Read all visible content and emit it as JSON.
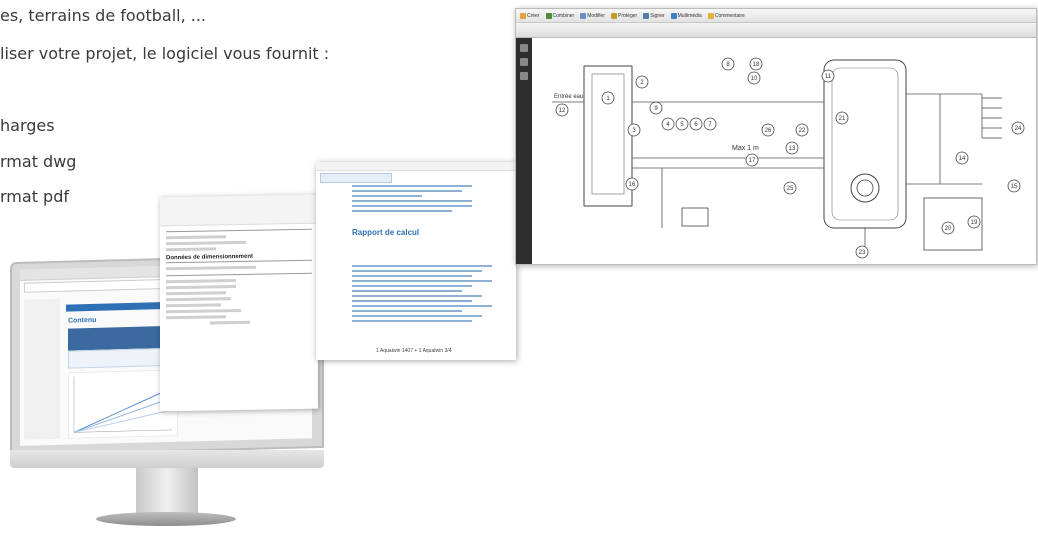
{
  "intro": {
    "line1": "es, terrains de football, ...",
    "line2": "liser votre projet, le logiciel vous fournit :",
    "line3": "harges",
    "line4": "rmat dwg",
    "line5": "rmat pdf"
  },
  "monitor_screen": {
    "page_title": "Contenu"
  },
  "form_window": {
    "section_title": "Données de dimensionnement"
  },
  "report_window": {
    "title": "Rapport de calcul",
    "footer": "1 Aquatwin 1407 + 1 Aquatwin 3/4"
  },
  "schematic_window": {
    "toolbar": [
      {
        "label": "Créer",
        "icon": "create-icon",
        "color": "#e8a13a"
      },
      {
        "label": "Combiner",
        "icon": "combine-icon",
        "color": "#4d8a3a"
      },
      {
        "label": "Modifier",
        "icon": "edit-icon",
        "color": "#6c8ec7"
      },
      {
        "label": "Protéger",
        "icon": "protect-icon",
        "color": "#c89a2e"
      },
      {
        "label": "Signer",
        "icon": "sign-icon",
        "color": "#5a78a8"
      },
      {
        "label": "Multimédia",
        "icon": "multimedia-icon",
        "color": "#3f7fbf"
      },
      {
        "label": "Commentaire",
        "icon": "comment-icon",
        "color": "#e2b23c"
      }
    ],
    "labels": {
      "inlet": "Entrée eau",
      "max_height": "Max 1 m"
    },
    "callouts": [
      "1",
      "2",
      "3",
      "4",
      "5",
      "6",
      "7",
      "8",
      "9",
      "10",
      "11",
      "12",
      "13",
      "14",
      "15",
      "16",
      "17",
      "18",
      "19",
      "20",
      "21",
      "22",
      "23",
      "24",
      "25",
      "26"
    ]
  }
}
